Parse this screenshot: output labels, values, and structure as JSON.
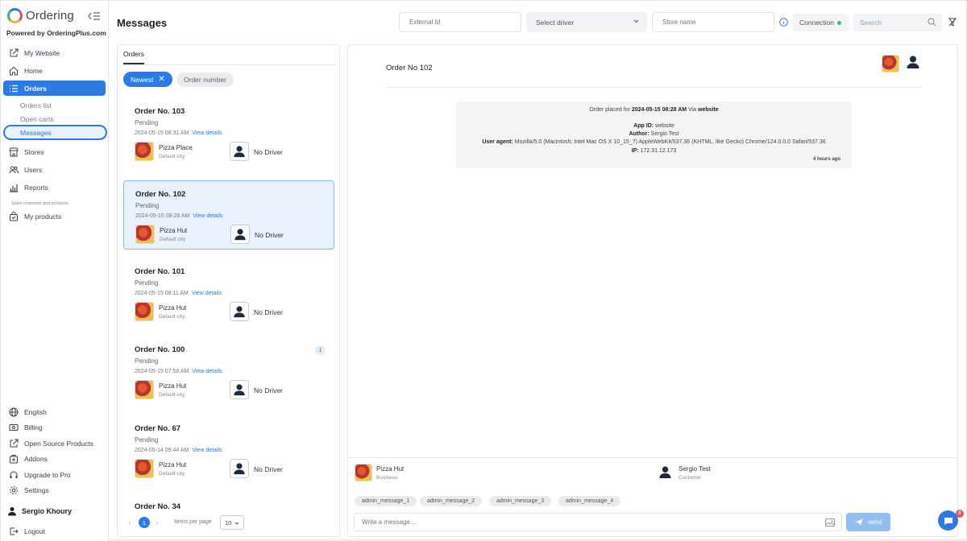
{
  "brand": {
    "name": "Ordering",
    "powered_by": "Powered by OrderingPlus.com"
  },
  "sidebar": {
    "items": {
      "my_website": "My Website",
      "home": "Home",
      "orders": "Orders",
      "orders_list": "Orders list",
      "open_carts": "Open carts",
      "messages": "Messages",
      "stores": "Stores",
      "users": "Users",
      "reports": "Reports",
      "section_caption": "Sales channels and products",
      "my_products": "My products",
      "english": "English",
      "billing": "Billing",
      "open_source": "Open Source Products",
      "addons": "Addons",
      "upgrade": "Upgrade to Pro",
      "settings": "Settings",
      "user_name": "Sergio Khoury",
      "logout": "Logout"
    }
  },
  "header": {
    "title": "Messages",
    "external_id_placeholder": "External Id",
    "select_driver": "Select driver",
    "store_name_placeholder": "Store name",
    "connection": "Connection",
    "search_placeholder": "Search"
  },
  "orders_panel": {
    "tab": "Orders",
    "chip_newest": "Newest",
    "chip_number": "Order number",
    "view_details": "View details",
    "orders": [
      {
        "title": "Order No. 103",
        "status": "Pending",
        "date": "2024-05-15 08:31 AM",
        "store": "Pizza Place",
        "city": "Default city",
        "driver": "No Driver",
        "badge": ""
      },
      {
        "title": "Order No. 102",
        "status": "Pending",
        "date": "2024-05-15 08:28 AM",
        "store": "Pizza Hut",
        "city": "Default city",
        "driver": "No Driver",
        "badge": ""
      },
      {
        "title": "Order No. 101",
        "status": "Pending",
        "date": "2024-05-15 08:11 AM",
        "store": "Pizza Hut",
        "city": "Default city",
        "driver": "No Driver",
        "badge": ""
      },
      {
        "title": "Order No. 100",
        "status": "Pending",
        "date": "2024-05-15 07:58 AM",
        "store": "Pizza Hut",
        "city": "Default city",
        "driver": "No Driver",
        "badge": "1"
      },
      {
        "title": "Order No. 67",
        "status": "Pending",
        "date": "2024-05-14 09:44 AM",
        "store": "Pizza Hut",
        "city": "Default city",
        "driver": "No Driver",
        "badge": ""
      },
      {
        "title": "Order No. 34",
        "status": "",
        "date": "",
        "store": "",
        "city": "",
        "driver": "",
        "badge": ""
      }
    ],
    "pager": {
      "page": "1",
      "items_per_page_label": "Items per page",
      "items_per_page": "10"
    }
  },
  "messages_panel": {
    "title": "Order No 102",
    "system": {
      "placed_prefix": "Order placed for",
      "placed_date": "2024-05-15 08:28 AM",
      "placed_via": "Via",
      "placed_channel": "website",
      "app_id_label": "App ID:",
      "app_id": "website",
      "author_label": "Author:",
      "author": "Sergio Test",
      "ua_label": "User agent:",
      "ua": "Mozilla/5.0 (Macintosh; Intel Mac OS X 10_15_7) AppleWebKit/537.36 (KHTML, like Gecko) Chrome/124.0.0.0 Safari/537.36",
      "ip_label": "IP:",
      "ip": "172.31.12.173",
      "time": "4 hours ago"
    },
    "participants": [
      {
        "name": "Pizza Hut",
        "role": "Business"
      },
      {
        "name": "Sergio Test",
        "role": "Customer"
      }
    ],
    "quick_messages": [
      "admin_message_1",
      "admin_message_2",
      "admin_message_3",
      "admin_message_4"
    ],
    "compose_placeholder": "Write a message...",
    "send_label": "send"
  },
  "chat_widget": {
    "badge": "8"
  },
  "colors": {
    "primary": "#2c7be5",
    "connected": "#2cc56f"
  }
}
